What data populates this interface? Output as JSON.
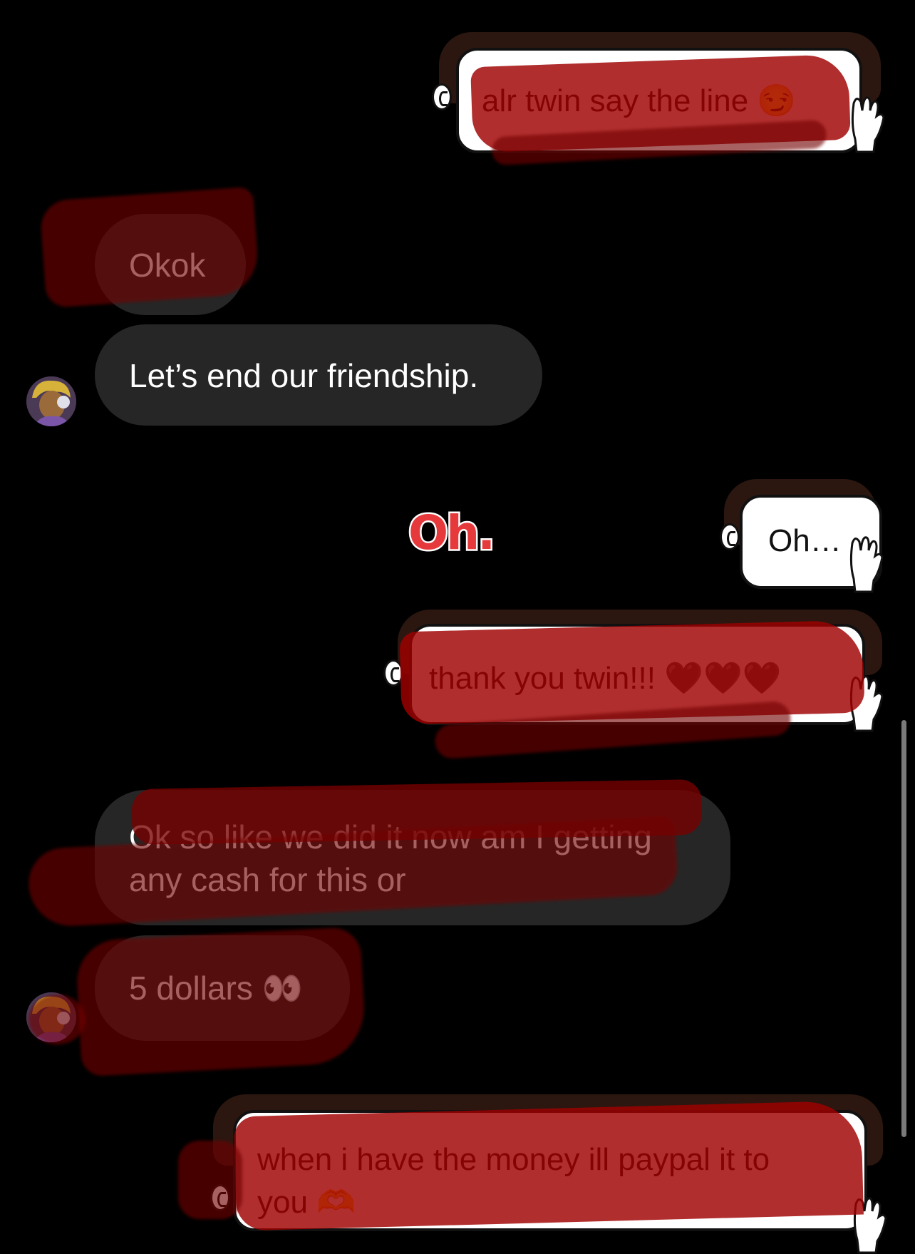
{
  "messages": {
    "sent_1": "alr twin say the line 😏",
    "recv_1": "Okok",
    "recv_2": "Let’s end our friendship.",
    "sticker_oh": "Oh.",
    "sent_2": "Oh…",
    "sent_3": "thank you twin!!! 🖤🖤🖤",
    "recv_3_line1": "Ok so like we did it now am I getting",
    "recv_3_line2": "any cash for this or",
    "recv_4": "5 dollars 👀",
    "sent_4_line1": "when i have the money ill paypal it to",
    "sent_4_line2": "you 🫶"
  },
  "colors": {
    "background": "#000000",
    "incoming_bubble": "#262626",
    "redaction": "#a00000",
    "sticker_red": "#e6393c",
    "hair": "#2b1710"
  },
  "icons": {
    "avatar": "contact-avatar",
    "hand": "hand-holding-sign-icon",
    "ear": "ear-icon"
  }
}
